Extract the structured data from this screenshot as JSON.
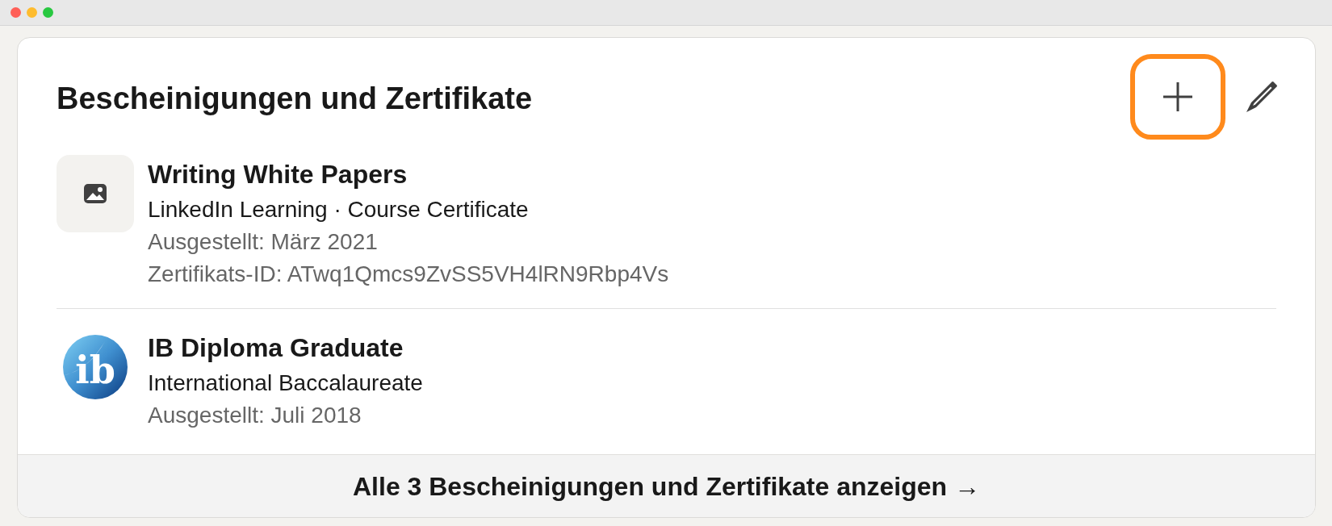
{
  "section": {
    "title": "Bescheinigungen und Zertifikate",
    "actions": [
      {
        "kind": "add",
        "highlighted": true
      },
      {
        "kind": "edit",
        "highlighted": false
      }
    ]
  },
  "items": [
    {
      "logo": {
        "kind": "image-placeholder"
      },
      "title": "Writing White Papers",
      "subtitle": "LinkedIn Learning · Course Certificate",
      "details": [
        "Ausgestellt: März 2021",
        "Zertifikats-ID: ATwq1Qmcs9ZvSS5VH4lRN9Rbp4Vs"
      ]
    },
    {
      "logo": {
        "kind": "emblem",
        "text": "ib"
      },
      "title": "IB Diploma Graduate",
      "subtitle": "International Baccalaureate",
      "details": [
        "Ausgestellt: Juli 2018"
      ]
    }
  ],
  "footer": {
    "label": "Alle 3 Bescheinigungen und Zertifikate anzeigen →"
  }
}
